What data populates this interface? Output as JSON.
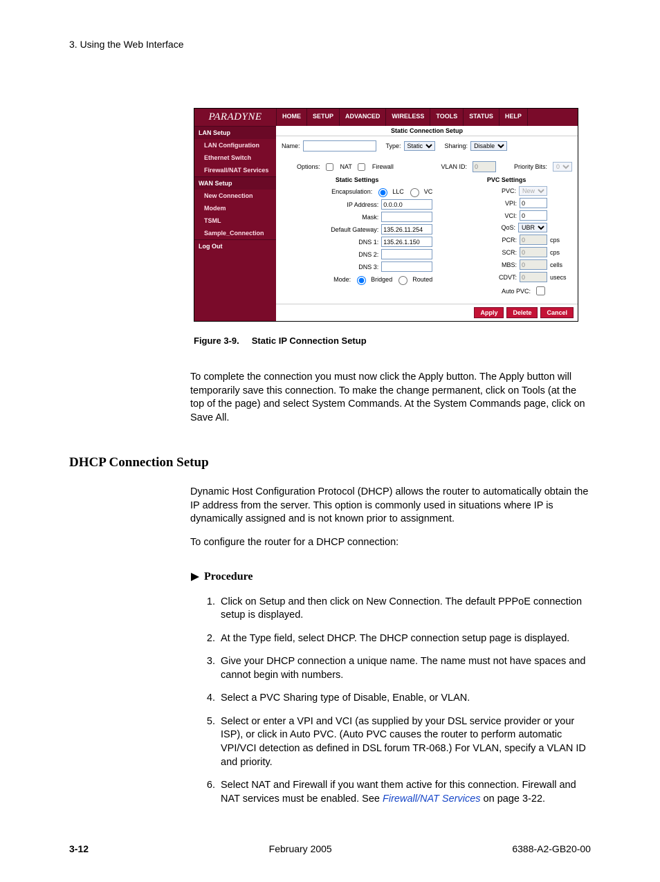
{
  "header": "3. Using the Web Interface",
  "figure": {
    "label": "Figure 3-9.",
    "title": "Static IP Connection Setup"
  },
  "ui": {
    "logo": "PARADYNE",
    "nav": [
      "HOME",
      "SETUP",
      "ADVANCED",
      "WIRELESS",
      "TOOLS",
      "STATUS",
      "HELP"
    ],
    "sidebar": {
      "lan_setup": "LAN Setup",
      "lan_items": [
        "LAN Configuration",
        "Ethernet Switch",
        "Firewall/NAT Services"
      ],
      "wan_setup": "WAN Setup",
      "wan_items": [
        "New Connection",
        "Modem",
        "TSML",
        "Sample_Connection"
      ],
      "logout": "Log Out"
    },
    "main_title": "Static Connection Setup",
    "top_fields": {
      "name_label": "Name:",
      "name_value": "",
      "type_label": "Type:",
      "type_value": "Static",
      "sharing_label": "Sharing:",
      "sharing_value": "Disable",
      "options_label": "Options:",
      "nat_label": "NAT",
      "firewall_label": "Firewall",
      "vlan_label": "VLAN ID:",
      "vlan_value": "0",
      "priority_label": "Priority Bits:",
      "priority_value": "0"
    },
    "static_settings": {
      "title": "Static Settings",
      "encapsulation_label": "Encapsulation:",
      "llc": "LLC",
      "vc": "VC",
      "ip_label": "IP Address:",
      "ip_value": "0.0.0.0",
      "mask_label": "Mask:",
      "mask_value": "",
      "gateway_label": "Default Gateway:",
      "gateway_value": "135.26.11.254",
      "dns1_label": "DNS 1:",
      "dns1_value": "135.26.1.150",
      "dns2_label": "DNS 2:",
      "dns2_value": "",
      "dns3_label": "DNS 3:",
      "dns3_value": "",
      "mode_label": "Mode:",
      "bridged": "Bridged",
      "routed": "Routed"
    },
    "pvc_settings": {
      "title": "PVC Settings",
      "pvc_label": "PVC:",
      "pvc_value": "New",
      "vpi_label": "VPI:",
      "vpi_value": "0",
      "vci_label": "VCI:",
      "vci_value": "0",
      "qos_label": "QoS:",
      "qos_value": "UBR",
      "pcr_label": "PCR:",
      "pcr_value": "0",
      "pcr_unit": "cps",
      "scr_label": "SCR:",
      "scr_value": "0",
      "scr_unit": "cps",
      "mbs_label": "MBS:",
      "mbs_value": "0",
      "mbs_unit": "cells",
      "cdvt_label": "CDVT:",
      "cdvt_value": "0",
      "cdvt_unit": "usecs",
      "autopvc_label": "Auto PVC:"
    },
    "buttons": {
      "apply": "Apply",
      "delete": "Delete",
      "cancel": "Cancel"
    }
  },
  "para1": "To complete the connection you must now click the Apply button. The Apply button will temporarily save this connection. To make the change permanent, click on Tools (at the top of the page) and select System Commands. At the System Commands page, click on Save All.",
  "section_title": "DHCP Connection Setup",
  "para2": "Dynamic Host Configuration Protocol (DHCP) allows the router to automatically obtain the IP address from the server. This option is commonly used in situations where IP is dynamically assigned and is not known prior to assignment.",
  "para3": "To configure the router for a DHCP connection:",
  "procedure_label": "Procedure",
  "steps": [
    "Click on Setup and then click on New Connection. The default PPPoE connection setup is displayed.",
    "At the Type field, select DHCP. The DHCP connection setup page is displayed.",
    "Give your DHCP connection a unique name. The name must not have spaces and cannot begin with numbers.",
    "Select a PVC Sharing type of Disable, Enable, or VLAN.",
    "Select or enter a VPI and VCI (as supplied by your DSL service provider or your ISP), or click in Auto PVC. (Auto PVC causes the router to perform automatic VPI/VCI detection as defined in DSL forum TR-068.) For VLAN, specify a VLAN ID and priority."
  ],
  "step6_a": "Select NAT and Firewall if you want them active for this connection. Firewall and NAT services must be enabled. See ",
  "step6_link": "Firewall/NAT Services",
  "step6_b": " on page 3-22.",
  "footer": {
    "left": "3-12",
    "center": "February 2005",
    "right": "6388-A2-GB20-00"
  }
}
